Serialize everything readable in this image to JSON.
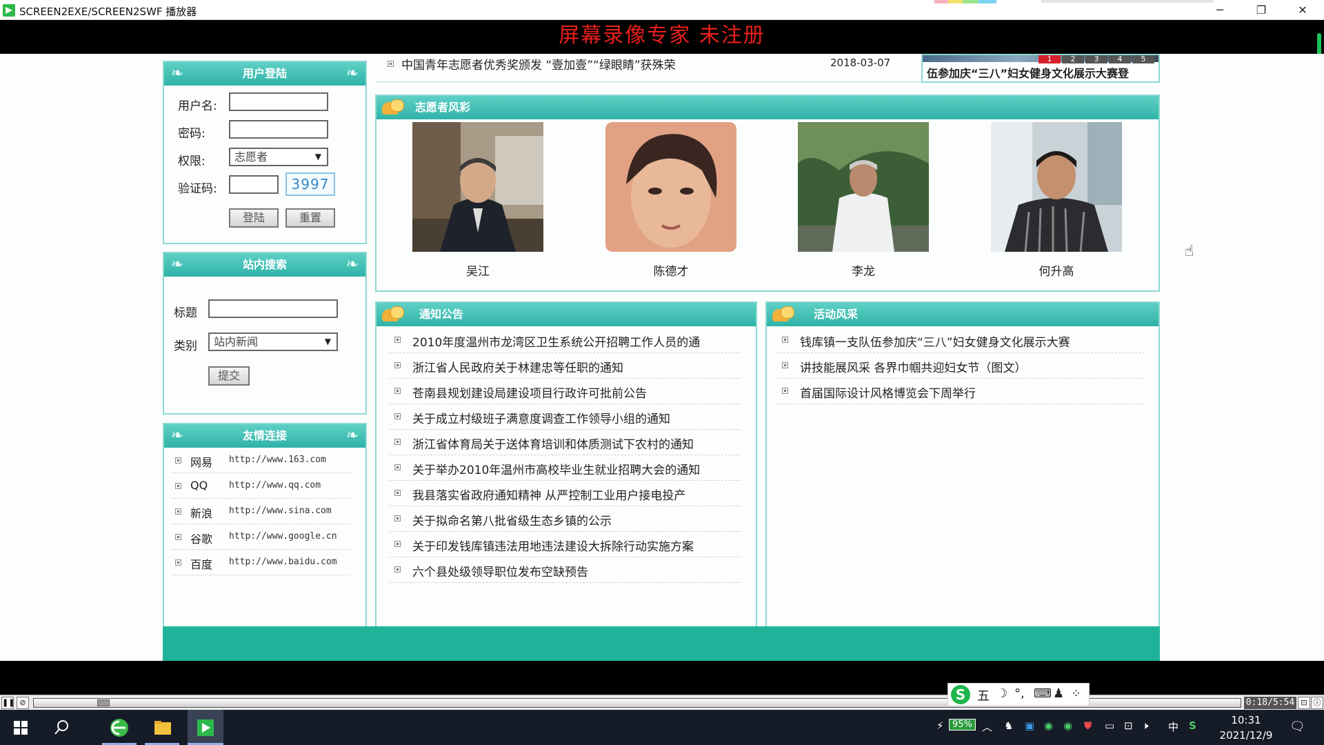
{
  "window": {
    "title": "SCREEN2EXE/SCREEN2SWF 播放器",
    "minimize": "─",
    "restore": "❐",
    "close": "✕"
  },
  "watermark": "屏幕录像专家  未注册",
  "top_news": {
    "title": "中国青年志愿者优秀奖颁发 “壹加壹”“绿眼睛”获殊荣",
    "date": "2018-03-07"
  },
  "slider": {
    "numbers": [
      "1",
      "2",
      "3",
      "4",
      "5"
    ],
    "caption": "伍参加庆“三八”妇女健身文化展示大赛登"
  },
  "login": {
    "header": "用户登陆",
    "username_label": "用户名:",
    "password_label": "密码:",
    "role_label": "权限:",
    "role_value": "志愿者",
    "captcha_label": "验证码:",
    "captcha_code": "3997",
    "login_button": "登陆",
    "reset_button": "重置"
  },
  "search": {
    "header": "站内搜索",
    "title_label": "标题",
    "category_label": "类别",
    "category_value": "站内新闻",
    "submit_button": "提交"
  },
  "links": {
    "header": "友情连接",
    "items": [
      {
        "name": "网易",
        "url": "http://www.163.com"
      },
      {
        "name": "QQ",
        "url": "http://www.qq.com"
      },
      {
        "name": "新浪",
        "url": "http://www.sina.com"
      },
      {
        "name": "谷歌",
        "url": "http://www.google.cn"
      },
      {
        "name": "百度",
        "url": "http://www.baidu.com"
      }
    ]
  },
  "volunteers": {
    "header": "志愿者风彩",
    "people": [
      {
        "name": "吴江"
      },
      {
        "name": "陈德才"
      },
      {
        "name": "李龙"
      },
      {
        "name": "何升高"
      }
    ]
  },
  "notices": {
    "header": "通知公告",
    "items": [
      "2010年度温州市龙湾区卫生系统公开招聘工作人员的通",
      "浙江省人民政府关于林建忠等任职的通知",
      "苍南县规划建设局建设项目行政许可批前公告",
      "关于成立村级班子满意度调查工作领导小组的通知",
      "浙江省体育局关于送体育培训和体质测试下农村的通知",
      "关于举办2010年温州市高校毕业生就业招聘大会的通知",
      "我县落实省政府通知精神 从严控制工业用户接电投产",
      "关于拟命名第八批省级生态乡镇的公示",
      "关于印发钱库镇违法用地违法建设大拆除行动实施方案",
      "六个县处级领导职位发布空缺预告"
    ]
  },
  "activities": {
    "header": "活动风采",
    "items": [
      "钱库镇一支队伍参加庆“三八”妇女健身文化展示大赛",
      "讲技能展风采 各界巾帼共迎妇女节（图文）",
      "首届国际设计风格博览会下周举行"
    ]
  },
  "player": {
    "timecode": "0:18/5:54"
  },
  "ime": {
    "items": [
      "五",
      "☽",
      "°,",
      "⌨",
      "♟",
      "⁘"
    ]
  },
  "taskbar": {
    "battery": "95%",
    "lang": "中",
    "time": "10:31",
    "date": "2021/12/9"
  },
  "colors": {
    "teal_header": "#2fb3a7",
    "watermark_red": "#e8201c",
    "footer_band": "#1fb39a"
  }
}
